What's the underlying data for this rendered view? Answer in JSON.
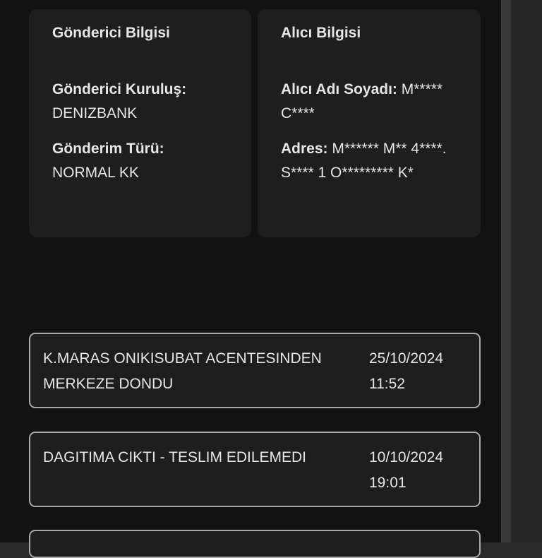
{
  "sender": {
    "title": "Gönderici Bilgisi",
    "institution_label": "Gönderici Kuruluş:",
    "institution_value": "DENIZBANK",
    "type_label": "Gönderim Türü:",
    "type_value": "NORMAL KK"
  },
  "recipient": {
    "title": "Alıcı Bilgisi",
    "name_label": "Alıcı Adı Soyadı:",
    "name_value": "M***** C****",
    "address_label": "Adres:",
    "address_value": "M****** M** 4****. S**** 1 O********* K*"
  },
  "events": [
    {
      "description": "K.MARAS ONIKISUBAT ACENTESINDEN MERKEZE DONDU",
      "date": "25/10/2024",
      "time": "11:52"
    },
    {
      "description": "DAGITIMA CIKTI - TESLIM EDILEMEDI",
      "date": "10/10/2024",
      "time": "19:01"
    }
  ],
  "colors": {
    "background": "#121212",
    "card": "#1e1e1e",
    "event_border": "#a9a9a9",
    "text": "#e6e6e6"
  }
}
